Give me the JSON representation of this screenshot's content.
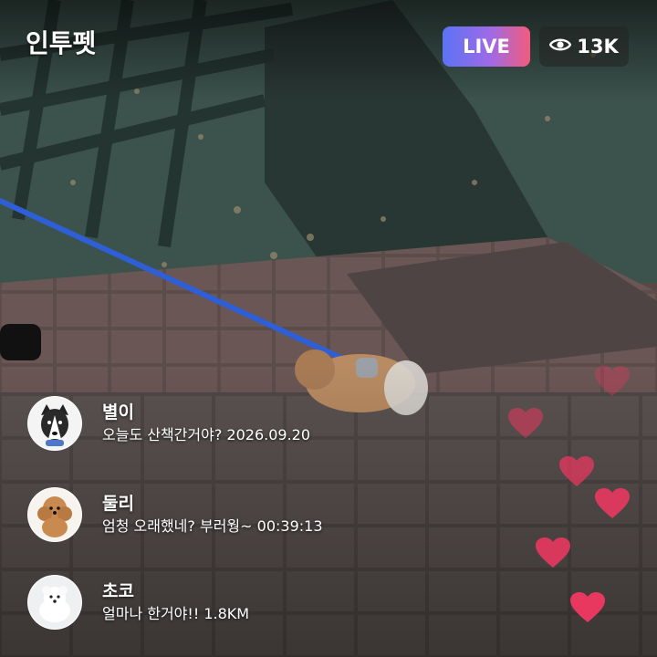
{
  "app": {
    "brand": "인투펫"
  },
  "stream": {
    "live_label": "LIVE",
    "viewer_count": "13K"
  },
  "comments": [
    {
      "name": "별이",
      "message": "오늘도 산책간거야? 2026.09.20",
      "avatar": "husky-avatar"
    },
    {
      "name": "둘리",
      "message": "엄청 오래했네? 부러웡~ 00:39:13",
      "avatar": "poodle-avatar"
    },
    {
      "name": "초코",
      "message": "얼마나 한거야!! 1.8KM",
      "avatar": "white-dog-avatar"
    }
  ],
  "colors": {
    "live_gradient": [
      "#5b73f5",
      "#9f6ae6",
      "#f25b7c"
    ],
    "heart": "#e8385f",
    "leash": "#2f5fd6"
  }
}
